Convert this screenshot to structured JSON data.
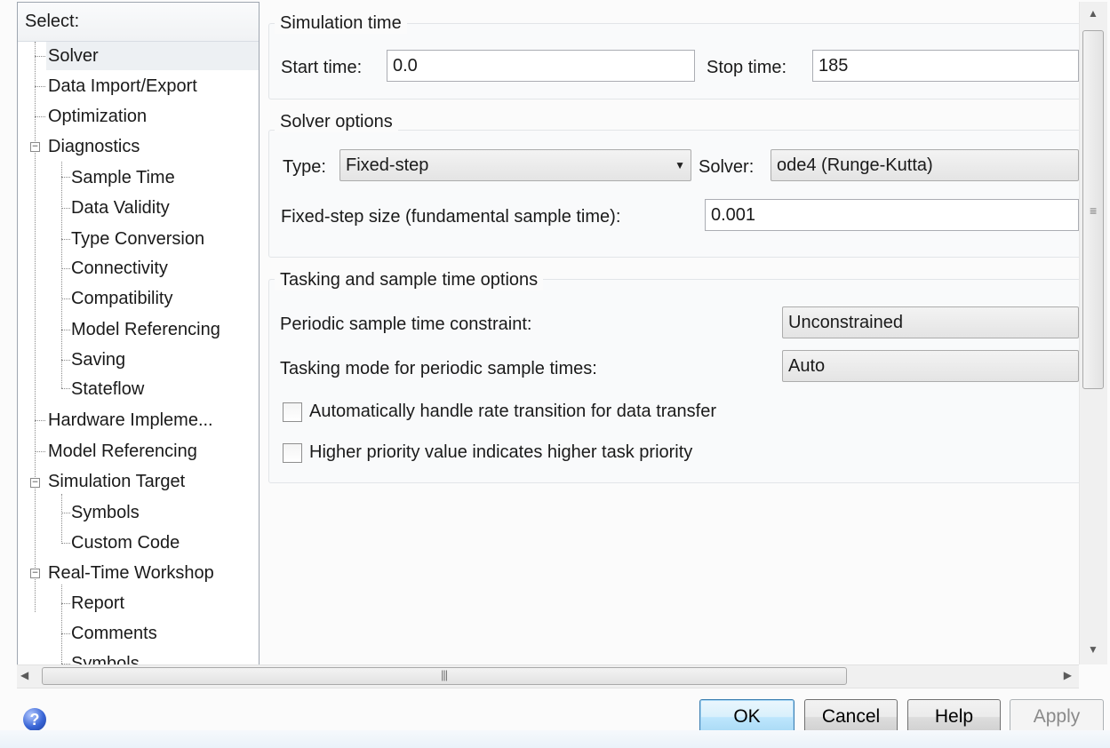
{
  "tree": {
    "header": "Select:",
    "items": [
      {
        "label": "Solver",
        "selected": true
      },
      {
        "label": "Data Import/Export"
      },
      {
        "label": "Optimization"
      },
      {
        "label": "Diagnostics"
      },
      {
        "label": "Sample Time"
      },
      {
        "label": "Data Validity"
      },
      {
        "label": "Type Conversion"
      },
      {
        "label": "Connectivity"
      },
      {
        "label": "Compatibility"
      },
      {
        "label": "Model Referencing"
      },
      {
        "label": "Saving"
      },
      {
        "label": "Stateflow"
      },
      {
        "label": "Hardware Impleme..."
      },
      {
        "label": "Model Referencing"
      },
      {
        "label": "Simulation Target"
      },
      {
        "label": "Symbols"
      },
      {
        "label": "Custom Code"
      },
      {
        "label": "Real-Time Workshop"
      },
      {
        "label": "Report"
      },
      {
        "label": "Comments"
      },
      {
        "label": "Symbols"
      }
    ]
  },
  "simulation_time": {
    "title": "Simulation time",
    "start_label": "Start time:",
    "start_value": "0.0",
    "stop_label": "Stop time:",
    "stop_value": "185"
  },
  "solver_options": {
    "title": "Solver options",
    "type_label": "Type:",
    "type_value": "Fixed-step",
    "solver_label": "Solver:",
    "solver_value": "ode4 (Runge-Kutta)",
    "step_label": "Fixed-step size (fundamental sample time):",
    "step_value": "0.001"
  },
  "tasking": {
    "title": "Tasking and sample time options",
    "periodic_label": "Periodic sample time constraint:",
    "periodic_value": "Unconstrained",
    "mode_label": "Tasking mode for periodic sample times:",
    "mode_value": "Auto",
    "rate_transition_label": "Automatically handle rate transition for data transfer",
    "rate_transition_checked": false,
    "priority_label": "Higher priority value indicates higher task priority",
    "priority_checked": false
  },
  "buttons": {
    "help_icon": "?",
    "ok": "OK",
    "cancel": "Cancel",
    "help": "Help",
    "apply": "Apply"
  },
  "icons": {
    "expander": "minus-box-icon",
    "combo_arrow": "dropdown-arrow-icon",
    "help": "help-circle-icon"
  }
}
